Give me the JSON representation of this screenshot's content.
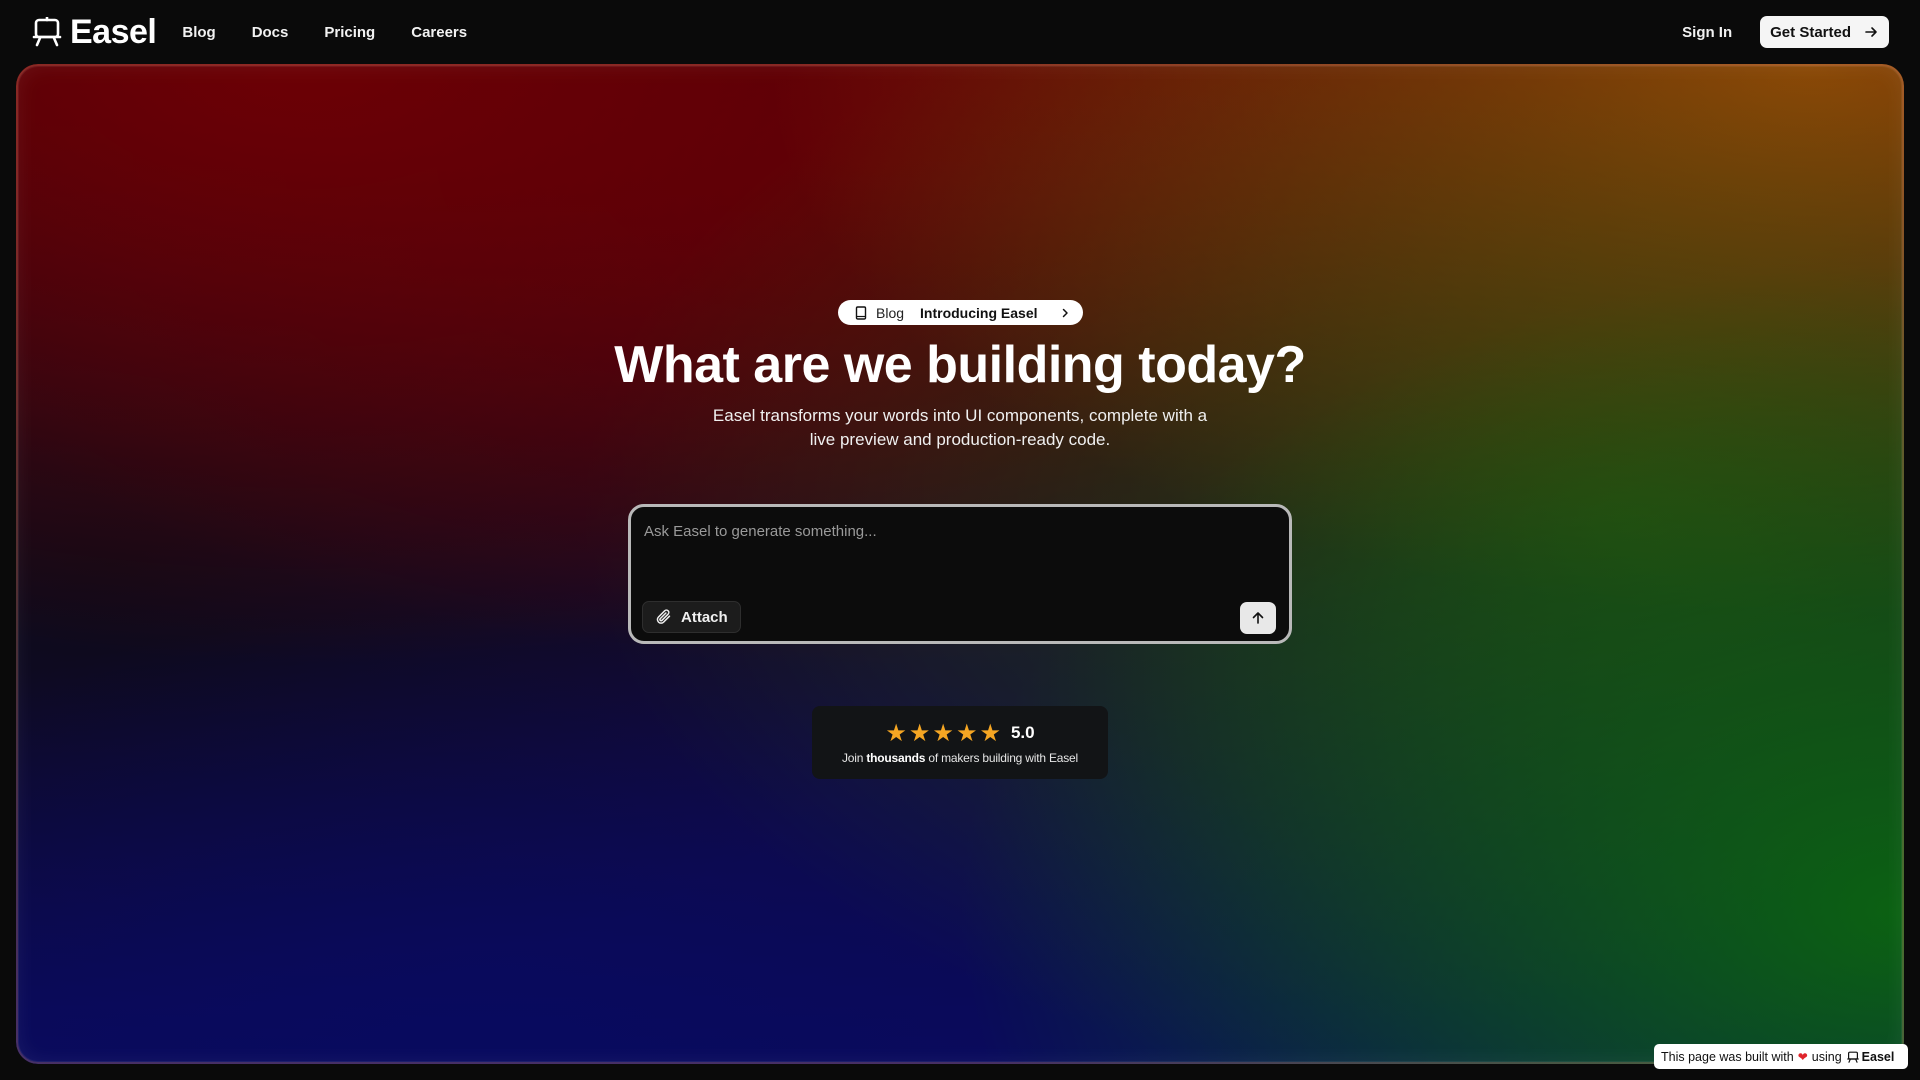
{
  "nav": {
    "brand": "Easel",
    "links": [
      "Blog",
      "Docs",
      "Pricing",
      "Careers"
    ],
    "sign_in": "Sign In",
    "get_started": "Get Started"
  },
  "hero": {
    "pill": {
      "icon": "book-icon",
      "tag": "Blog",
      "title": "Introducing Easel"
    },
    "headline": "What are we building today?",
    "subhead": "Easel transforms your words into UI components, complete with a live preview and production-ready code.",
    "prompt": {
      "placeholder": "Ask Easel to generate something...",
      "value": "",
      "attach_label": "Attach"
    },
    "rating": {
      "stars": 5,
      "value": "5.0",
      "caption_prefix": "Join",
      "caption_bold": "thousands",
      "caption_suffix": "of makers building with Easel"
    }
  },
  "badge": {
    "text_prefix": "This page was built with",
    "text_using": "using",
    "brand": "Easel"
  },
  "colors": {
    "accent_star": "#f5a623",
    "heart": "#e0252b",
    "background": "#0a0a0a"
  }
}
